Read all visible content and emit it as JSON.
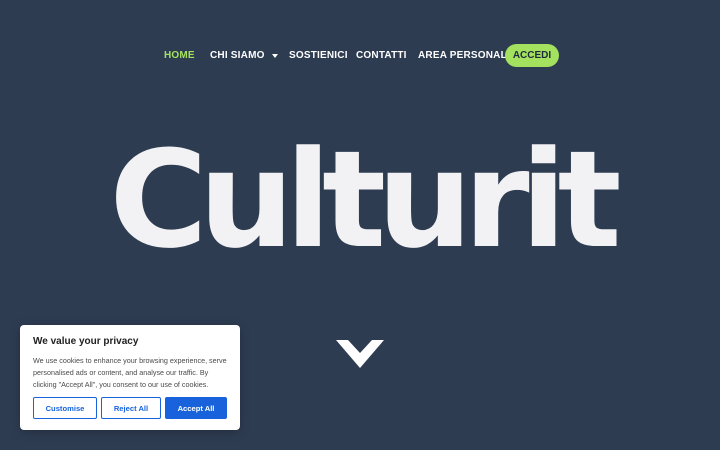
{
  "nav": {
    "items": [
      {
        "label": "HOME"
      },
      {
        "label": "CHI SIAMO"
      },
      {
        "label": "SOSTIENICI"
      },
      {
        "label": "CONTATTI"
      },
      {
        "label": "AREA PERSONALE"
      }
    ],
    "login_label": "ACCEDI"
  },
  "hero": {
    "logo_text": "Culturit",
    "scroll_icon": "chevron-down-icon"
  },
  "cookie_banner": {
    "title": "We value your privacy",
    "text": "We use cookies to enhance your browsing experience, serve personalised ads or content, and analyse our traffic. By clicking \"Accept All\", you consent to our use of cookies.",
    "customise_label": "Customise",
    "reject_label": "Reject All",
    "accept_label": "Accept All"
  },
  "colors": {
    "background": "#2e3c52",
    "accent": "#a3e15f",
    "logo": "#f2f2f4",
    "cookie_button": "#1863dc"
  }
}
